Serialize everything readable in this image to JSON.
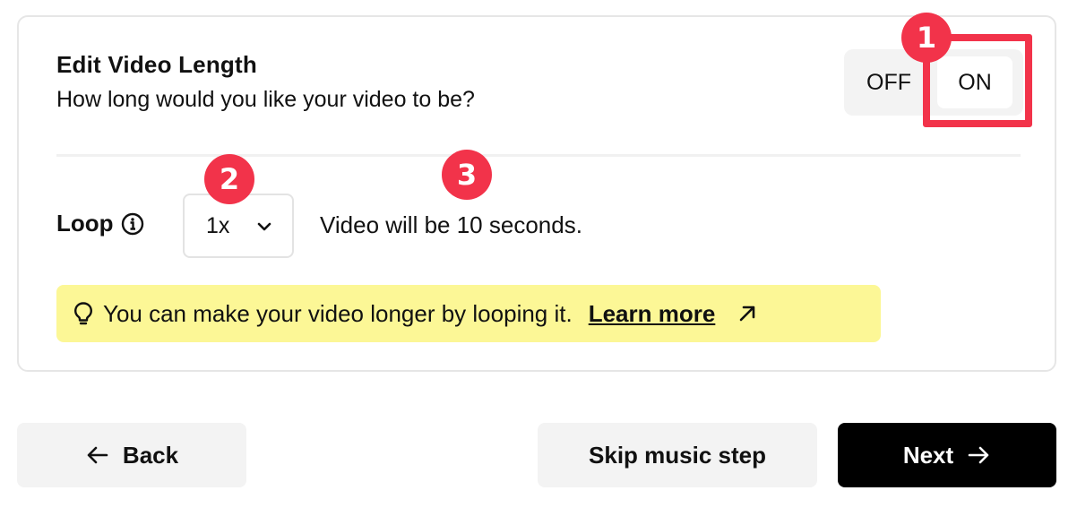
{
  "card": {
    "title": "Edit Video Length",
    "subtitle": "How long would you like your video to be?",
    "toggle": {
      "off_label": "OFF",
      "on_label": "ON",
      "selected": "ON"
    },
    "loop": {
      "label": "Loop",
      "info_icon": "info-icon",
      "select_value": "1x",
      "chevron_icon": "chevron-down-icon"
    },
    "duration_text": "Video will be 10 seconds.",
    "tip": {
      "icon": "lightbulb-icon",
      "text": "You can make your video longer by looping it.",
      "link": "Learn more",
      "link_icon": "external-arrow-icon"
    }
  },
  "annotations": {
    "badge1": "1",
    "badge2": "2",
    "badge3": "3"
  },
  "footer": {
    "back_label": "Back",
    "skip_label": "Skip music step",
    "next_label": "Next"
  },
  "colors": {
    "accent": "#f2334a",
    "tip_background": "#fcf796",
    "primary_button": "#000000",
    "secondary_button": "#f3f3f3"
  }
}
